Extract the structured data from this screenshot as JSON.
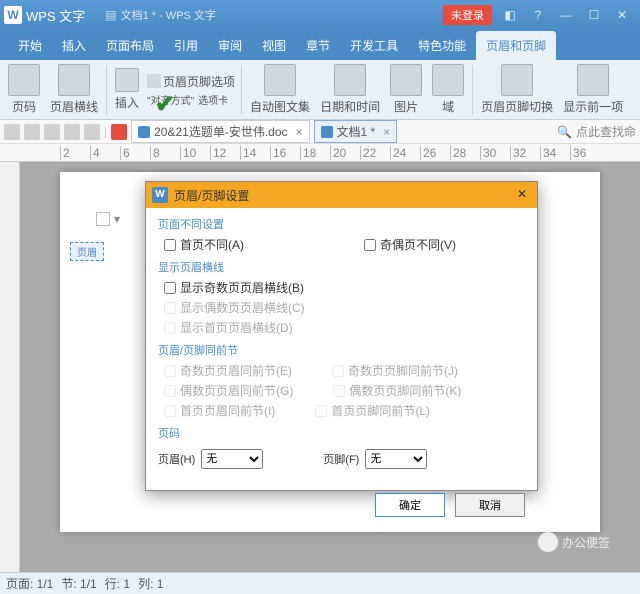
{
  "titlebar": {
    "app": "WPS 文字",
    "doc": "文档1 * - WPS 文字",
    "unlogged": "未登录"
  },
  "tabs": [
    "开始",
    "插入",
    "页面布局",
    "引用",
    "审阅",
    "视图",
    "章节",
    "开发工具",
    "特色功能",
    "页眉和页脚"
  ],
  "activeTab": 9,
  "ribbon": {
    "page_num": "页码",
    "hf_line": "页眉横线",
    "insert": "插入",
    "options": "页眉页脚选项",
    "align": "\"对齐方式\"",
    "tabs": "选项卡",
    "auto_text": "自动图文集",
    "date_time": "日期和时间",
    "picture": "图片",
    "field": "域",
    "hf_switch": "页眉页脚切换",
    "show_prev": "显示前一项"
  },
  "doctabs": [
    {
      "name": "20&21选题单-安世伟.doc",
      "active": false
    },
    {
      "name": "文档1 *",
      "active": true
    }
  ],
  "search_placeholder": "点此查找命",
  "ruler_ticks": [
    "2",
    "4",
    "6",
    "8",
    "10",
    "12",
    "14",
    "16",
    "18",
    "20",
    "22",
    "24",
    "26",
    "28",
    "30",
    "32",
    "34",
    "36"
  ],
  "hf_label": "页眉",
  "status": {
    "page": "页面: 1/1",
    "sect": "节: 1/1",
    "row": "行: 1",
    "col": "列: 1"
  },
  "watermark": "办公便签",
  "dialog": {
    "title": "页眉/页脚设置",
    "s1": "页面不同设置",
    "cb_first": "首页不同(A)",
    "cb_odd_even": "奇偶页不同(V)",
    "s2": "显示页眉横线",
    "cb_show_odd": "显示奇数页页眉横线(B)",
    "cb_show_even": "显示偶数页页眉横线(C)",
    "cb_show_first": "显示首页页眉横线(D)",
    "s3": "页眉/页脚同前节",
    "cb_odd_h": "奇数页页眉同前节(E)",
    "cb_odd_f": "奇数页页脚同前节(J)",
    "cb_even_h": "偶数页页眉同前节(G)",
    "cb_even_f": "偶数页页脚同前节(K)",
    "cb_first_h": "首页页眉同前节(I)",
    "cb_first_f": "首页页脚同前节(L)",
    "s4": "页码",
    "header_lbl": "页眉(H)",
    "footer_lbl": "页脚(F)",
    "none": "无",
    "ok": "确定",
    "cancel": "取消"
  }
}
